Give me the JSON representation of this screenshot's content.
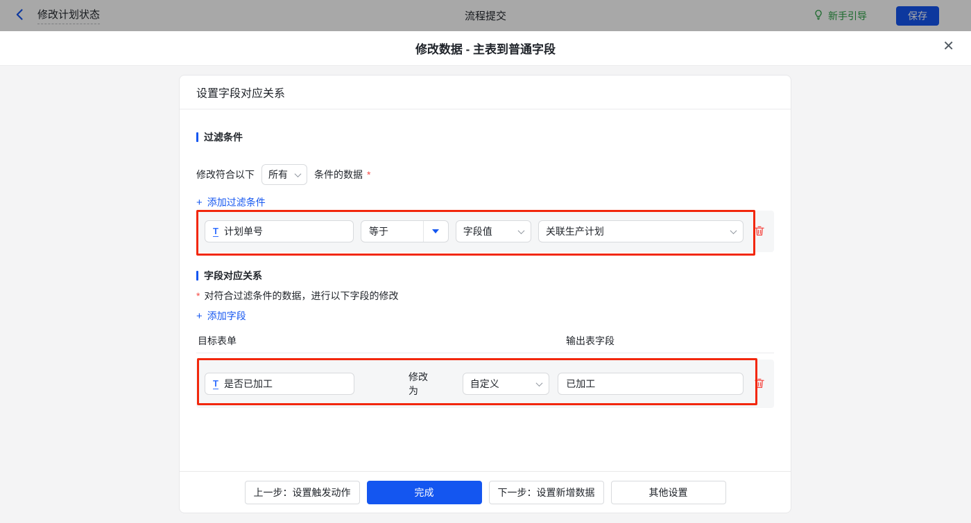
{
  "colors": {
    "accent_blue": "#1456F0",
    "link_blue": "#1456F0",
    "field_icon_blue": "#3370FF",
    "danger_red": "#F54A45",
    "annotation_red": "#F2270C",
    "guide_green": "#2BA245"
  },
  "topbar": {
    "back_label": "修改计划状态",
    "center_title": "流程提交",
    "guide_label": "新手引导",
    "save_label": "保存"
  },
  "dialog": {
    "title": "修改数据 - 主表到普通字段",
    "close_glyph": "✕"
  },
  "panel": {
    "header": "设置字段对应关系",
    "filter_section": {
      "title": "过滤条件",
      "match_prefix": "修改符合以下",
      "match_select_value": "所有",
      "match_suffix": "条件的数据",
      "required_mark": "*",
      "add_icon": "+",
      "add_label": "添加过滤条件",
      "row": {
        "field_icon": "T",
        "field": "计划单号",
        "operator": "等于",
        "value_type": "字段值",
        "value": "关联生产计划"
      }
    },
    "mapping_section": {
      "title": "字段对应关系",
      "required_mark": "*",
      "description": "对符合过滤条件的数据，进行以下字段的修改",
      "add_icon": "+",
      "add_label": "添加字段",
      "col_target": "目标表单",
      "col_output": "输出表字段",
      "row": {
        "field_icon": "T",
        "field": "是否已加工",
        "action_label": "修改为",
        "value_type": "自定义",
        "value": "已加工"
      }
    },
    "footer": {
      "prev": "上一步：设置触发动作",
      "done": "完成",
      "next": "下一步：设置新增数据",
      "other": "其他设置"
    }
  }
}
